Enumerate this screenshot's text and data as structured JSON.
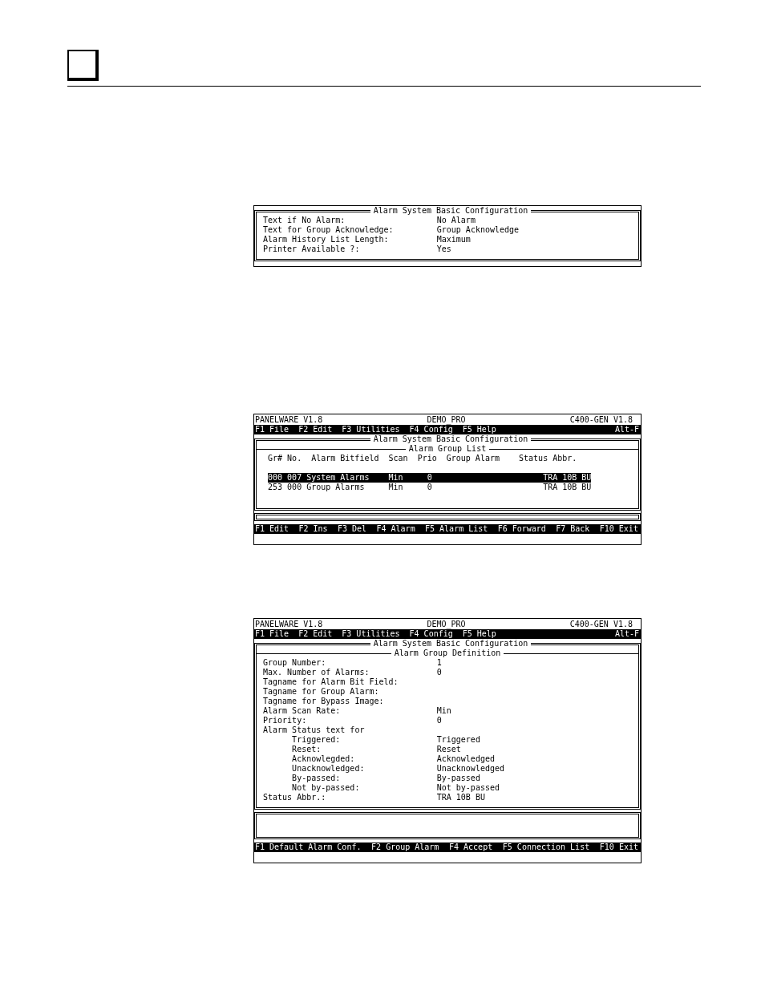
{
  "screens": [
    {
      "kind": "dialog",
      "title": "Alarm System Basic Configuration",
      "fields": [
        {
          "label": "Text if No Alarm:",
          "value": "No Alarm"
        },
        {
          "label": "Text for Group Acknowledge:",
          "value": "Group Acknowledge"
        },
        {
          "label": "Alarm History List Length:",
          "value": "Maximum"
        },
        {
          "label": "Printer Available ?:",
          "value": "Yes"
        }
      ]
    },
    {
      "kind": "list",
      "header": {
        "app": "PANELWARE V1.8",
        "project": "DEMO_PRO",
        "version": "C400-GEN V1.8"
      },
      "menu": [
        "F1 File",
        "F2 Edit",
        "F3 Utilities",
        "F4 Config",
        "F5 Help"
      ],
      "menu_hint": "Alt-F",
      "title": "Alarm System Basic Configuration",
      "subtitle": "Alarm Group List",
      "columns": [
        "Gr# No.",
        "Alarm Bitfield",
        "Scan",
        "Prio",
        "Group Alarm",
        "Status Abbr."
      ],
      "rows": [
        {
          "group": "000 007 System Alarms",
          "scan": "Min",
          "prio": "0",
          "status": "TRA 10B BU",
          "selected": true
        },
        {
          "group": "253 000 Group Alarms",
          "scan": "Min",
          "prio": "0",
          "status": "TRA 10B BU",
          "selected": false
        }
      ],
      "function_keys": [
        "F1 Edit",
        "F2 Ins",
        "F3 Del",
        "F4 Alarm",
        "F5 Alarm List",
        "F6 Forward",
        "F7 Back",
        "F10 Exit"
      ]
    },
    {
      "kind": "form",
      "header": {
        "app": "PANELWARE V1.8",
        "project": "DEMO_PRO",
        "version": "C400-GEN V1.8"
      },
      "menu": [
        "F1 File",
        "F2 Edit",
        "F3 Utilities",
        "F4 Config",
        "F5 Help"
      ],
      "menu_hint": "Alt-F",
      "title": "Alarm System Basic Configuration",
      "subtitle": "Alarm Group Definition",
      "fields": [
        {
          "label": "Group Number:",
          "value": "1"
        },
        {
          "label": "Max. Number of Alarms:",
          "value": "0"
        },
        {
          "label": "Tagname for Alarm Bit Field:"
        },
        {
          "label": "Tagname for Group Alarm:"
        },
        {
          "label": "Tagname for Bypass Image:"
        },
        {
          "label": "Alarm Scan Rate:",
          "value": "Min"
        },
        {
          "label": "Priority:",
          "value": "0"
        },
        {
          "label": "Alarm Status text for",
          "children": [
            {
              "label": "Triggered:",
              "value": "Triggered"
            },
            {
              "label": "Reset:",
              "value": "Reset"
            },
            {
              "label": "Acknowlegded:",
              "value": "Acknowledged"
            },
            {
              "label": "Unacknowledged:",
              "value": "Unacknowledged"
            },
            {
              "label": "By-passed:",
              "value": "By-passed"
            },
            {
              "label": "Not by-passed:",
              "value": "Not by-passed"
            }
          ]
        },
        {
          "label": "Status Abbr.:",
          "value": "TRA 10B BU"
        }
      ],
      "function_keys": [
        "F1 Default Alarm Conf.",
        "F2 Group Alarm",
        "F4 Accept",
        "F5 Connection List",
        "F10 Exit"
      ]
    }
  ]
}
